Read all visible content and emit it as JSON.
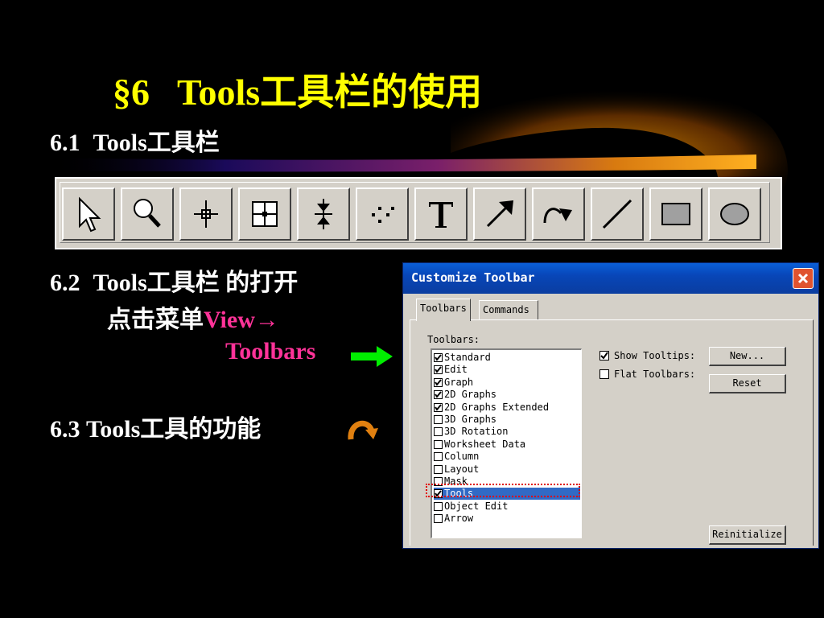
{
  "slide": {
    "section_mark": "§6",
    "title": "Tools工具栏的使用",
    "s61": {
      "num": "6.1",
      "text": "Tools工具栏"
    },
    "s62": {
      "num": "6.2",
      "text": "Tools工具栏 的打开",
      "line2_prefix": "点击菜单",
      "line2_view": "View→",
      "line3": "Toolbars"
    },
    "s63": {
      "num": "6.3",
      "text": "Tools工具的功能"
    }
  },
  "toolbar": {
    "tools": [
      {
        "name": "pointer-icon"
      },
      {
        "name": "zoom-icon"
      },
      {
        "name": "screen-reader-icon"
      },
      {
        "name": "data-reader-icon"
      },
      {
        "name": "data-selector-icon"
      },
      {
        "name": "draw-data-icon"
      },
      {
        "name": "text-tool-icon"
      },
      {
        "name": "arrow-tool-icon"
      },
      {
        "name": "curved-arrow-tool-icon"
      },
      {
        "name": "line-tool-icon"
      },
      {
        "name": "rectangle-tool-icon"
      },
      {
        "name": "oval-tool-icon"
      }
    ]
  },
  "dialog": {
    "title": "Customize Toolbar",
    "tabs": [
      "Toolbars",
      "Commands"
    ],
    "toolbars_label": "Toolbars",
    "list": [
      {
        "label": "Standard",
        "checked": true
      },
      {
        "label": "Edit",
        "checked": true
      },
      {
        "label": "Graph",
        "checked": true
      },
      {
        "label": "2D Graphs",
        "checked": true
      },
      {
        "label": "2D Graphs Extended",
        "checked": true
      },
      {
        "label": "3D Graphs",
        "checked": false
      },
      {
        "label": "3D Rotation",
        "checked": false
      },
      {
        "label": "Worksheet Data",
        "checked": false
      },
      {
        "label": "Column",
        "checked": false
      },
      {
        "label": "Layout",
        "checked": false
      },
      {
        "label": "Mask",
        "checked": false
      },
      {
        "label": "Tools",
        "checked": true,
        "selected": true
      },
      {
        "label": "Object Edit",
        "checked": false
      },
      {
        "label": "Arrow",
        "checked": false
      }
    ],
    "show_tooltips": {
      "label": "Show Tooltips",
      "checked": true
    },
    "flat_toolbars": {
      "label": "Flat Toolbars",
      "checked": false
    },
    "btn_new": "New...",
    "btn_reset": "Reset",
    "btn_reinit": "Reinitialize"
  },
  "colors": {
    "title": "#ffff00",
    "accent_pink": "#ff3399",
    "arrow_green": "#00ee00",
    "selection": "#316ac5"
  }
}
